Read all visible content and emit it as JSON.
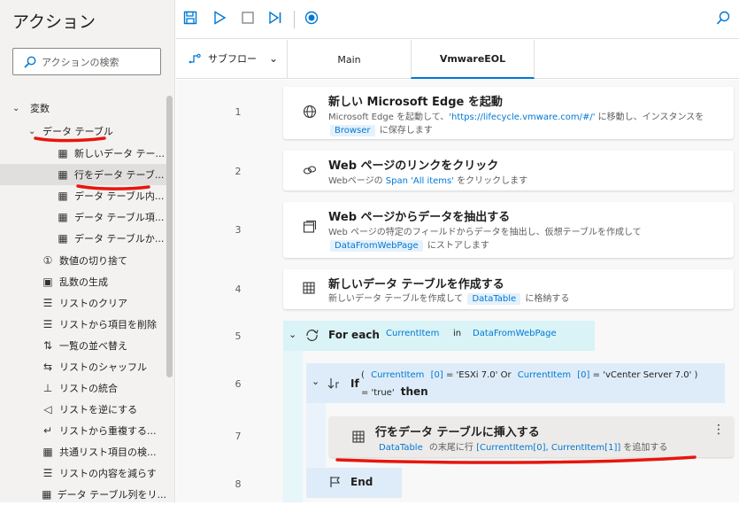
{
  "actions_pane": {
    "title": "アクション",
    "search_placeholder": "アクションの検索",
    "items": [
      {
        "label": "変数",
        "icon": "chevron-down-icon"
      },
      {
        "label": "データ テーブル",
        "icon": "chevron-down-icon"
      },
      {
        "label": "新しいデータ テー...",
        "icon": "table-icon"
      },
      {
        "label": "行をデータ テーブ...",
        "icon": "table-icon"
      },
      {
        "label": "データ テーブル内...",
        "icon": "table-icon"
      },
      {
        "label": "データ テーブル項...",
        "icon": "table-icon"
      },
      {
        "label": "データ テーブルか...",
        "icon": "table-icon"
      },
      {
        "label": "数値の切り捨て",
        "icon": "number-icon"
      },
      {
        "label": "乱数の生成",
        "icon": "random-icon"
      },
      {
        "label": "リストのクリア",
        "icon": "list-clear-icon"
      },
      {
        "label": "リストから項目を削除",
        "icon": "list-remove-icon"
      },
      {
        "label": "一覧の並べ替え",
        "icon": "sort-icon"
      },
      {
        "label": "リストのシャッフル",
        "icon": "shuffle-icon"
      },
      {
        "label": "リストの統合",
        "icon": "merge-icon"
      },
      {
        "label": "リストを逆にする",
        "icon": "reverse-icon"
      },
      {
        "label": "リストから重複する...",
        "icon": "dedupe-icon"
      },
      {
        "label": "共通リスト項目の検...",
        "icon": "common-icon"
      },
      {
        "label": "リストの内容を減らす",
        "icon": "reduce-icon"
      },
      {
        "label": "データ テーブル列をリ...",
        "icon": "table-column-icon"
      }
    ]
  },
  "tabs": {
    "subflow_label": "サブフロー",
    "items": [
      {
        "label": "Main"
      },
      {
        "label": "VmwareEOL"
      }
    ]
  },
  "flow": {
    "line_numbers": [
      "1",
      "2",
      "3",
      "4",
      "5",
      "6",
      "7",
      "8"
    ],
    "steps": [
      {
        "title": "新しい Microsoft Edge を起動",
        "d1": "Microsoft Edge を起動して、",
        "d2": "'https://lifecycle.vmware.com/#/'",
        "d3": " に移動し、インスタンスを",
        "d4": "Browser",
        "d5": " に保存します"
      },
      {
        "title": "Web ページのリンクをクリック",
        "d1": "Webページの ",
        "d2": "Span 'All items'",
        "d3": " をクリックします"
      },
      {
        "title": "Web ページからデータを抽出する",
        "d1": "Web ページの特定のフィールドからデータを抽出し、仮想テーブルを作成して",
        "d2": "DataFromWebPage",
        "d3": " にストアします"
      },
      {
        "title": "新しいデータ テーブルを作成する",
        "d1": "新しいデータ テーブルを作成して ",
        "d2": "DataTable",
        "d3": " に格納する"
      },
      {
        "title": "For each",
        "var1": "CurrentItem",
        "in": "in",
        "var2": "DataFromWebPage"
      },
      {
        "title": "If",
        "p1": "(",
        "v1": "CurrentItem",
        "i1": "[0]",
        "eq1": "= 'ESXi 7.0'",
        "or": "Or",
        "v2": "CurrentItem",
        "i2": "[0]",
        "eq2": "= 'vCenter Server 7.0'",
        "p2": ")",
        "eq3": "= 'true'",
        "then": "then"
      },
      {
        "title": "行をデータ テーブルに挿入する",
        "d1": "DataTable",
        "d2": " の末尾に行 ",
        "d3": "[CurrentItem[0], CurrentItem[1]]",
        "d4": " を追加する"
      },
      {
        "title": "End"
      }
    ]
  }
}
